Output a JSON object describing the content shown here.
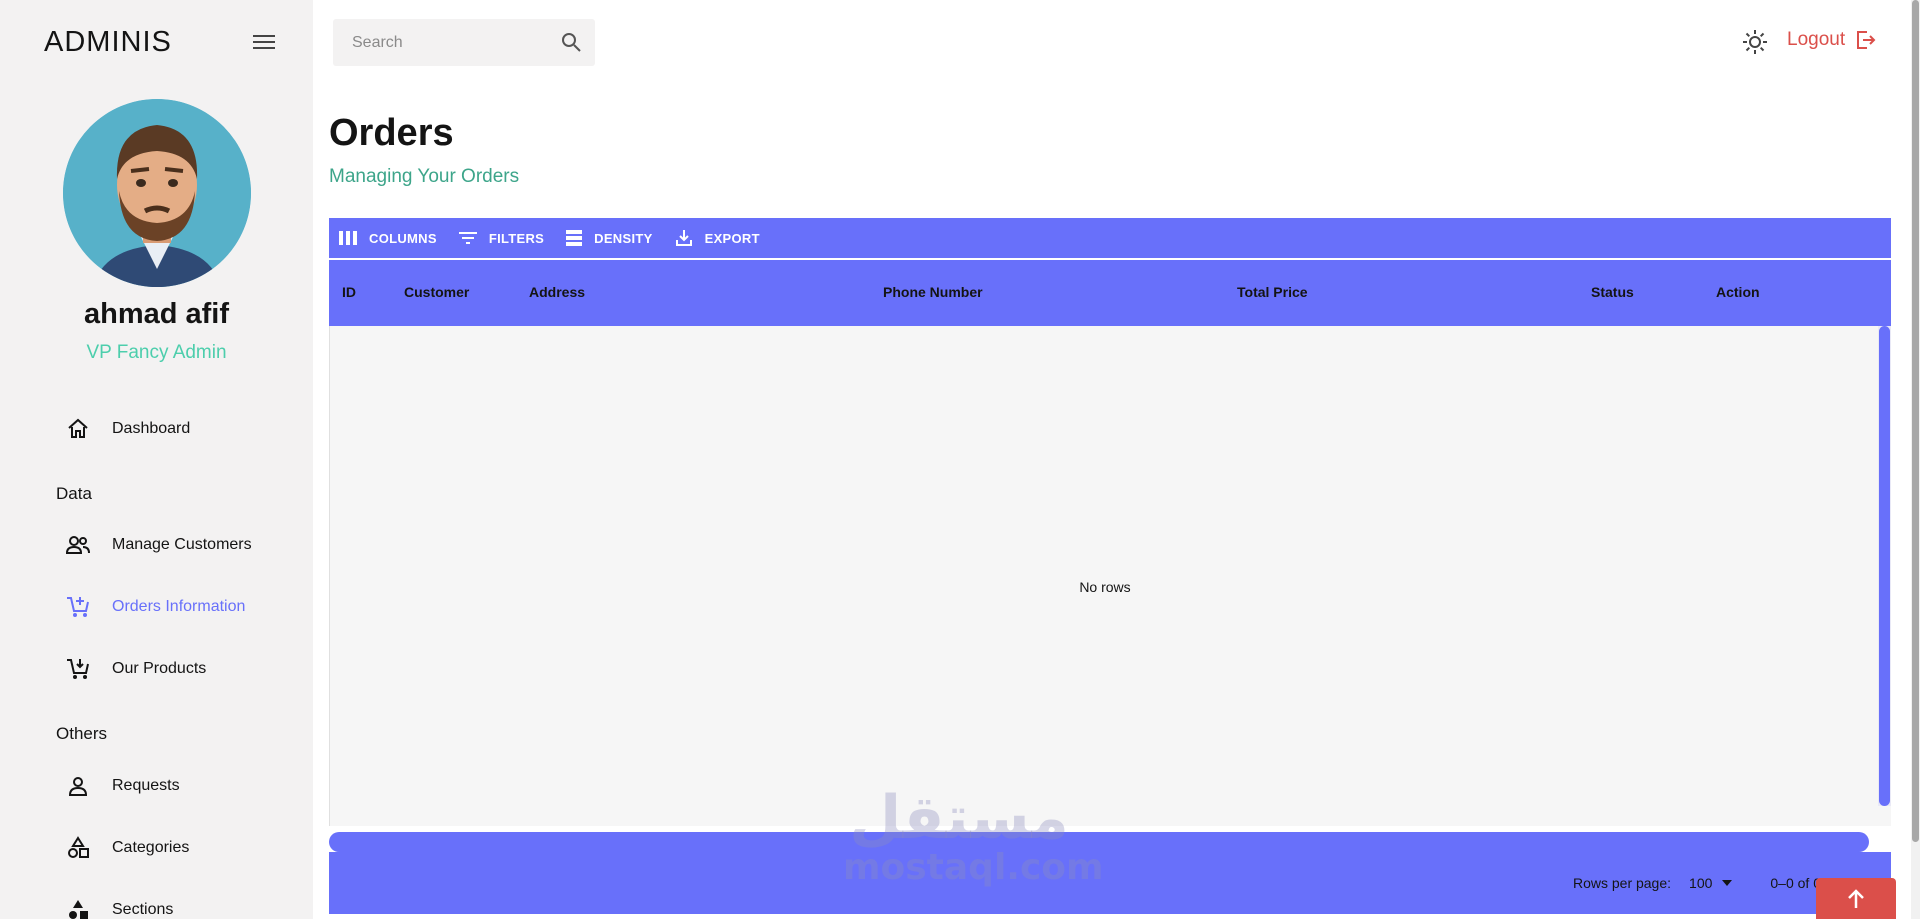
{
  "app": {
    "brand": "ADMINIS"
  },
  "user": {
    "name": "ahmad afif",
    "role": "VP Fancy Admin"
  },
  "sidebar": {
    "items": [
      {
        "label": "Dashboard",
        "icon": "home-icon"
      },
      {
        "section": "Data"
      },
      {
        "label": "Manage Customers",
        "icon": "people-icon"
      },
      {
        "label": "Orders Information",
        "icon": "cart-add-icon",
        "active": true
      },
      {
        "label": "Our Products",
        "icon": "cart-icon"
      },
      {
        "section": "Others"
      },
      {
        "label": "Requests",
        "icon": "person-icon"
      },
      {
        "label": "Categories",
        "icon": "category-icon"
      },
      {
        "label": "Sections",
        "icon": "shapes-icon"
      }
    ]
  },
  "topbar": {
    "search_placeholder": "Search",
    "logout_label": "Logout"
  },
  "header": {
    "title": "Orders",
    "subtitle": "Managing Your Orders"
  },
  "grid": {
    "toolbar": {
      "columns": "COLUMNS",
      "filters": "FILTERS",
      "density": "DENSITY",
      "export": "EXPORT"
    },
    "columns": [
      "ID",
      "Customer",
      "Address",
      "Phone Number",
      "Total Price",
      "Status",
      "Action"
    ],
    "empty_text": "No rows",
    "footer": {
      "rows_per_page_label": "Rows per page:",
      "rows_per_page_value": "100",
      "page_range": "0–0 of 0"
    }
  },
  "watermark": {
    "arabic": "مستقل",
    "latin": "mostaql.com"
  },
  "colors": {
    "accent": "#6870fa",
    "green_text": "#4cceac",
    "subtitle": "#3da58a",
    "danger": "#db4f4a",
    "sidebar_bg": "#f3f2f2"
  }
}
